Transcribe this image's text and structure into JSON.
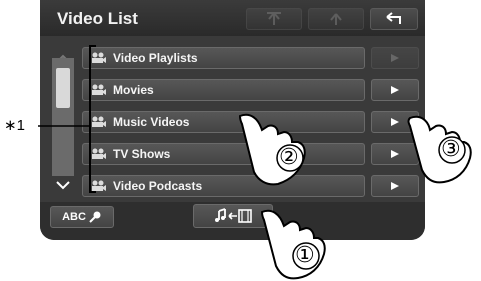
{
  "header": {
    "title": "Video List"
  },
  "list": {
    "items": [
      {
        "label": "Video Playlists"
      },
      {
        "label": "Movies"
      },
      {
        "label": "Music Videos"
      },
      {
        "label": "TV Shows"
      },
      {
        "label": "Video Podcasts"
      }
    ]
  },
  "bottom": {
    "abc_label": "ABC"
  },
  "annotations": {
    "marker": "∗1",
    "step1": "①",
    "step2": "②",
    "step3": "③"
  },
  "colors": {
    "screen": "#3a3a3a",
    "row": "#4d4d4d",
    "text": "#f5f5f5"
  }
}
